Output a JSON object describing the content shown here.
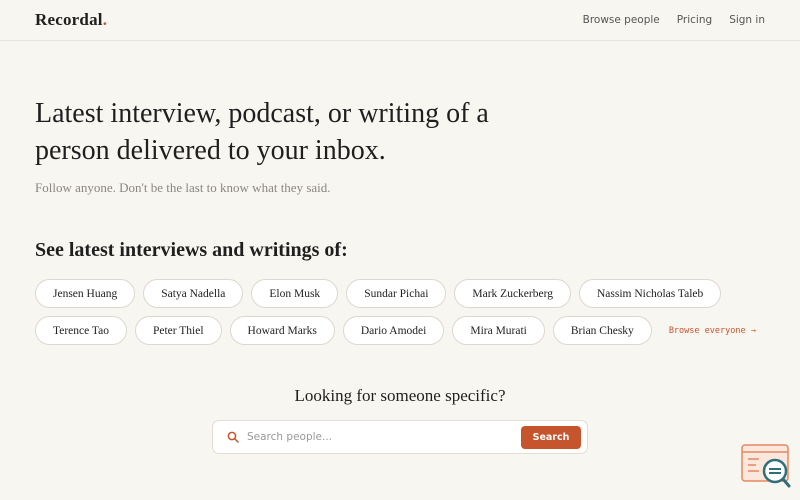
{
  "header": {
    "logo_text": "Recordal",
    "logo_dot": ".",
    "nav": [
      {
        "label": "Browse people"
      },
      {
        "label": "Pricing"
      },
      {
        "label": "Sign in"
      }
    ]
  },
  "hero": {
    "title_line1": "Latest interview, podcast, or writing of a",
    "title_line2": "person delivered to your inbox.",
    "subtitle": "Follow anyone. Don't be the last to know what they said."
  },
  "people_section": {
    "title": "See latest interviews and writings of:",
    "row1": [
      "Jensen Huang",
      "Satya Nadella",
      "Elon Musk",
      "Sundar Pichai",
      "Mark Zuckerberg",
      "Nassim Nicholas Taleb"
    ],
    "row2": [
      "Terence Tao",
      "Peter Thiel",
      "Howard Marks",
      "Dario Amodei",
      "Mira Murati",
      "Brian Chesky"
    ],
    "browse_all": "Browse everyone →"
  },
  "search": {
    "heading": "Looking for someone specific?",
    "placeholder": "Search people...",
    "button_label": "Search"
  },
  "colors": {
    "accent": "#c6552d",
    "background": "#f8f6f1",
    "widget_blue": "#2e6f7a"
  }
}
